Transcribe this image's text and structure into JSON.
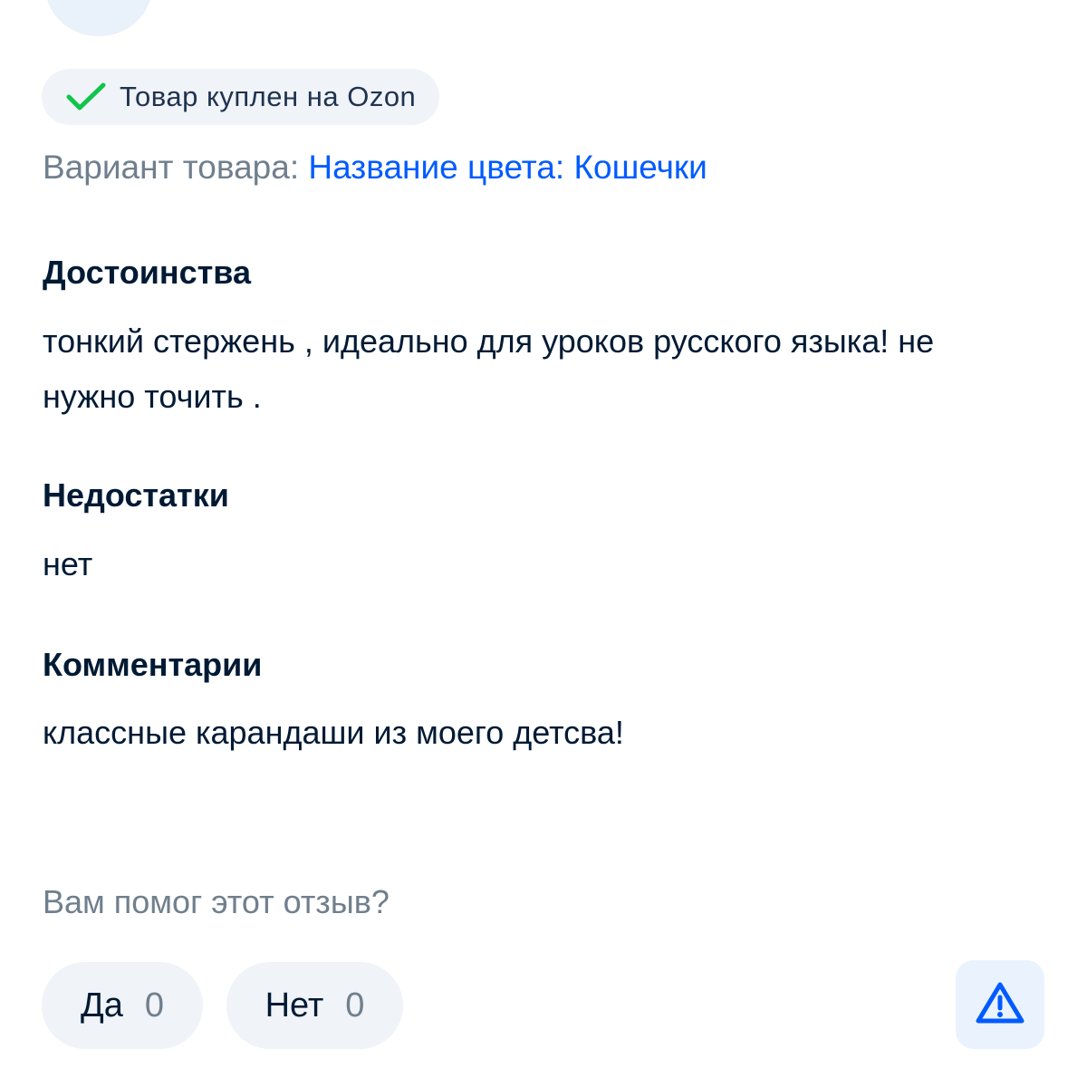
{
  "badge": {
    "icon": "checkmark-icon",
    "text": "Товар куплен на Ozon",
    "check_color": "#10c44c"
  },
  "variant": {
    "label": "Вариант товара:",
    "value": "Название цвета: Кошечки"
  },
  "sections": [
    {
      "title": "Достоинства",
      "body": "тонкий стержень , идеально для уроков русского языка! не нужно точить ."
    },
    {
      "title": "Недостатки",
      "body": "нет"
    },
    {
      "title": "Комментарии",
      "body": "классные карандаши из моего детсва!"
    }
  ],
  "helpful": {
    "question": "Вам помог этот отзыв?",
    "yes_label": "Да",
    "yes_count": "0",
    "no_label": "Нет",
    "no_count": "0"
  },
  "report": {
    "icon": "warning-triangle-icon",
    "color": "#005bff"
  },
  "colors": {
    "accent": "#005bff",
    "text": "#001a34",
    "muted": "#707f8d"
  }
}
